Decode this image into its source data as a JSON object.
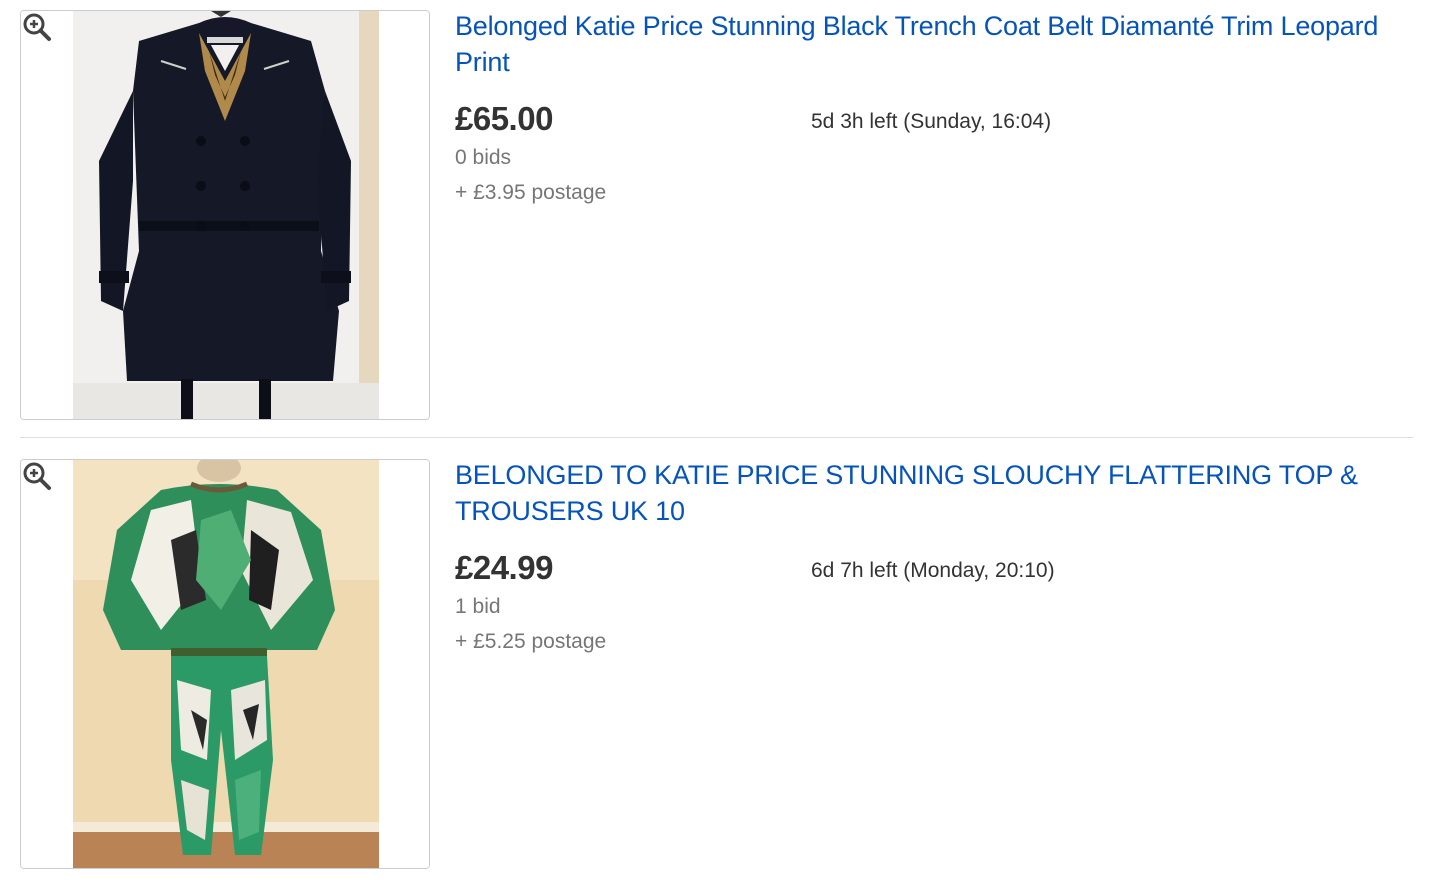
{
  "listings": [
    {
      "title": "Belonged Katie Price Stunning Black Trench Coat Belt Diamanté Trim Leopard Print",
      "price": "£65.00",
      "bids": "0 bids",
      "postage": "+ £3.95 postage",
      "time_left": "5d 3h left (Sunday, 16:04)",
      "image_icon": "black-trench-coat-photo",
      "zoom_icon": "zoom-in-icon"
    },
    {
      "title": "BELONGED TO KATIE PRICE STUNNING SLOUCHY FLATTERING TOP & TROUSERS UK 10",
      "price": "£24.99",
      "bids": "1 bid",
      "postage": "+ £5.25 postage",
      "time_left": "6d 7h left (Monday, 20:10)",
      "image_icon": "green-print-outfit-photo",
      "zoom_icon": "zoom-in-icon"
    }
  ],
  "colors": {
    "link": "#0654ba",
    "price": "#333333",
    "muted": "#767676"
  }
}
